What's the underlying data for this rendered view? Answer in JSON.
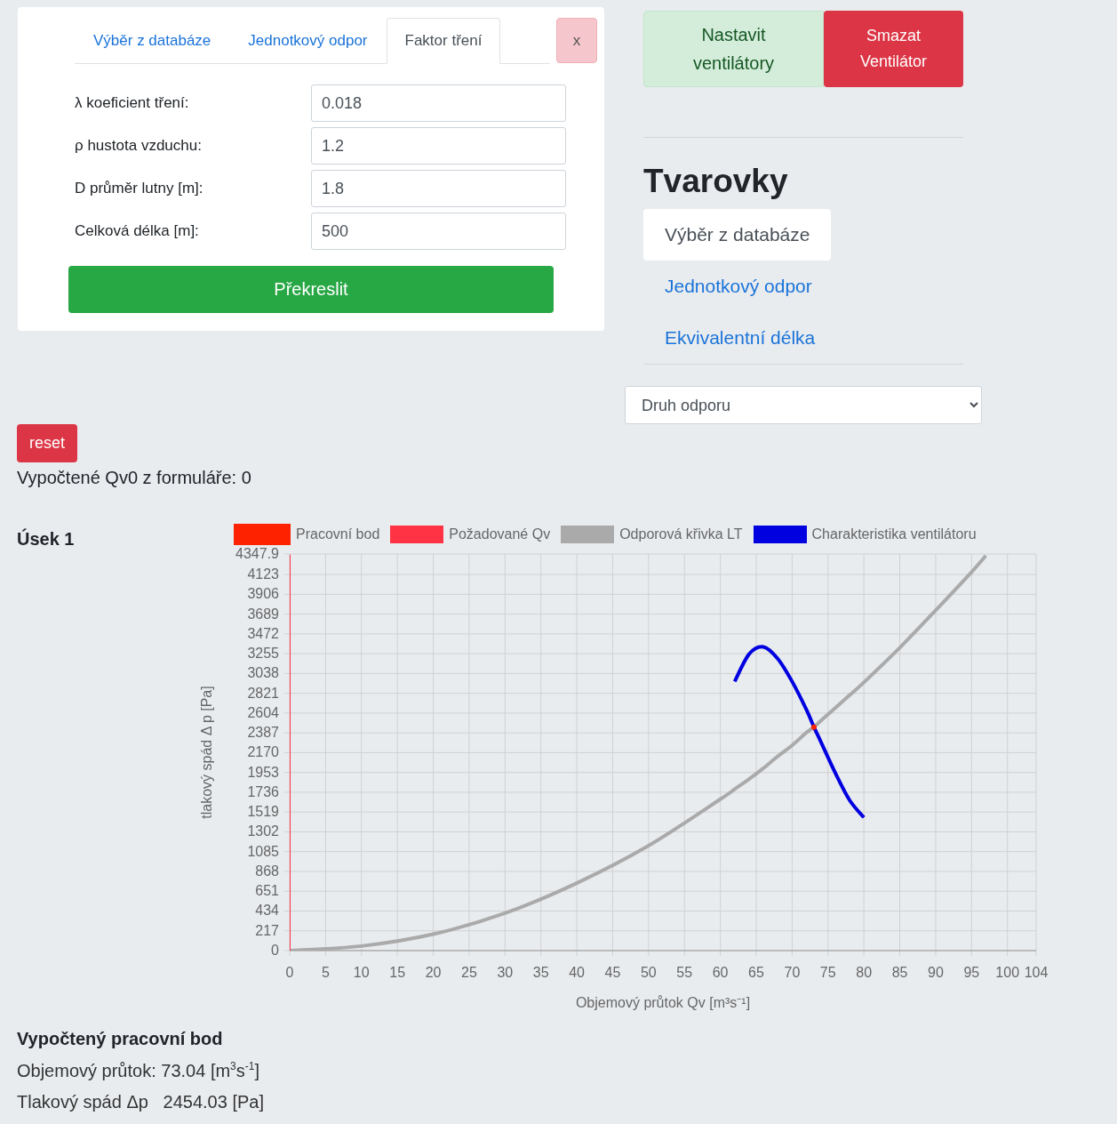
{
  "friction_card": {
    "tabs": [
      {
        "label": "Výběr z databáze",
        "selected": false
      },
      {
        "label": "Jednotkový odpor",
        "selected": false
      },
      {
        "label": "Faktor tření",
        "selected": true
      }
    ],
    "close_button": "x",
    "fields": [
      {
        "label": "λ koeficient tření:",
        "value": "0.018"
      },
      {
        "label": "ρ hustota vzduchu:",
        "value": "1.2"
      },
      {
        "label": "D průměr lutny [m]:",
        "value": "1.8"
      },
      {
        "label": "Celková délka [m]:",
        "value": "500"
      }
    ],
    "redraw_button": "Překreslit"
  },
  "fan_buttons": [
    {
      "label": "Nastavit ventilátory",
      "kind": "light"
    },
    {
      "label": "Smazat Ventilátor",
      "kind": "danger"
    }
  ],
  "fittings": {
    "title": "Tvarovky",
    "tabs": [
      {
        "label": "Výběr z databáze",
        "selected": true
      },
      {
        "label": "Jednotkový odpor",
        "selected": false
      },
      {
        "label": "Ekvivalentní délka",
        "selected": false
      }
    ],
    "select": {
      "value": "Druh odporu"
    }
  },
  "reset_button": "reset",
  "computed_qv0": "Vypočtené Qv0 z formuláře: 0",
  "section": {
    "title": "Úsek 1",
    "chart_data": {
      "type": "line",
      "xlabel": "Objemový průtok Qv [m³s⁻¹]",
      "ylabel": "tlakový spád Δ p [Pa]",
      "x": [
        0,
        0,
        10,
        20,
        30,
        40,
        50,
        60,
        62,
        64,
        66,
        68,
        70,
        72,
        73.04,
        74,
        76,
        78,
        80,
        85,
        90,
        95,
        97
      ],
      "series": [
        {
          "name": "Pracovní bod",
          "color": "#ff2200",
          "marker": "circle",
          "values": [
            null,
            null,
            null,
            null,
            null,
            null,
            null,
            null,
            null,
            null,
            null,
            null,
            null,
            null,
            2450,
            null,
            null,
            null,
            null,
            null,
            null,
            null,
            null
          ]
        },
        {
          "name": "Požadované Qv",
          "color": "#ff3344",
          "values": [
            0,
            4340,
            null,
            null,
            null,
            null,
            null,
            null,
            null,
            null,
            null,
            null,
            null,
            null,
            null,
            null,
            null,
            null,
            null,
            null,
            null,
            null,
            null
          ]
        },
        {
          "name": "Odporová křivka LT",
          "color": "#aaaaaa",
          "values": [
            0,
            0,
            50,
            180,
            410,
            740,
            1150,
            1660,
            1770,
            1880,
            2000,
            2130,
            2250,
            2390,
            2450,
            2520,
            2660,
            2800,
            2940,
            3320,
            3730,
            4150,
            4330
          ]
        },
        {
          "name": "Charakteristika ventilátoru",
          "color": "#0000e0",
          "values": [
            null,
            null,
            null,
            null,
            null,
            null,
            null,
            null,
            2950,
            3250,
            3330,
            3200,
            2950,
            2640,
            2450,
            2290,
            1950,
            1650,
            1460,
            null,
            null,
            null,
            null
          ]
        }
      ],
      "grid": true,
      "legend": true,
      "xlim": [
        0,
        104
      ],
      "ylim": [
        0,
        4347.9
      ],
      "xticks": [
        0,
        5,
        10,
        15,
        20,
        25,
        30,
        35,
        40,
        45,
        50,
        55,
        60,
        65,
        70,
        75,
        80,
        85,
        90,
        95,
        100,
        104
      ],
      "yticks": [
        0,
        217,
        434,
        651,
        868,
        1085,
        1302,
        1519,
        1736,
        1953,
        2170,
        2387,
        2604,
        2821,
        3038,
        3255,
        3472,
        3689,
        3906,
        4123,
        4347.9
      ]
    }
  },
  "result": {
    "title": "Vypočtený pracovní bod",
    "lines": [
      "Objemový průtok: 73.04 [m$^{3}$s$^{-1}$]",
      "Tlakový spád Δp   2454.03 [Pa]"
    ]
  }
}
